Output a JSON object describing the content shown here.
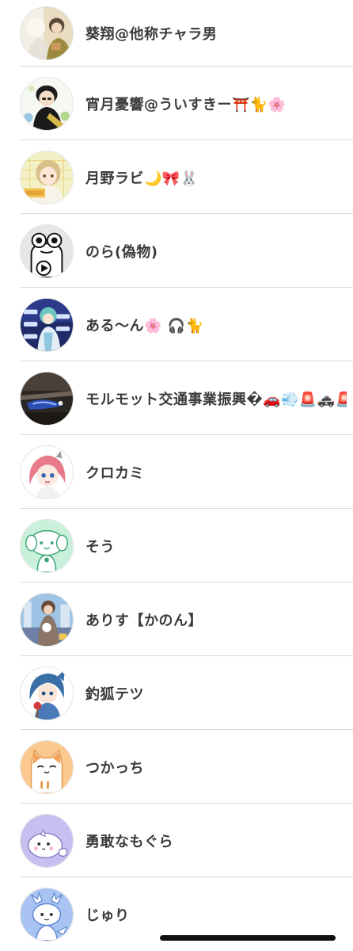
{
  "users": [
    {
      "name": "葵翔@他称チャラ男",
      "avatar": "photo-avatar-icon"
    },
    {
      "name": "宵月憂響@ういすきー⛩️🐈🌸",
      "avatar": "illustration-avatar-icon"
    },
    {
      "name": "月野ラビ🌙🎀🐰",
      "avatar": "illustration-avatar-icon"
    },
    {
      "name": "のら(偽物)",
      "avatar": "frog-avatar-icon"
    },
    {
      "name": "ある〜ん🌸 🎧🐈",
      "avatar": "illustration-avatar-icon"
    },
    {
      "name": "モルモット交通事業振興�🚗💨🚨🚓🚨",
      "avatar": "photo-avatar-icon"
    },
    {
      "name": "クロカミ",
      "avatar": "illustration-avatar-icon"
    },
    {
      "name": "そう",
      "avatar": "illustration-avatar-icon"
    },
    {
      "name": "ありす【かのん】",
      "avatar": "illustration-avatar-icon"
    },
    {
      "name": "釣狐テツ",
      "avatar": "illustration-avatar-icon"
    },
    {
      "name": "つかっち",
      "avatar": "cat-avatar-icon"
    },
    {
      "name": "勇敢なもぐら",
      "avatar": "seal-avatar-icon"
    },
    {
      "name": "じゅり",
      "avatar": "dragon-avatar-icon"
    }
  ],
  "colors": {
    "text": "#3b3b3b",
    "separator": "#d9d9de",
    "home_indicator": "#111111"
  }
}
